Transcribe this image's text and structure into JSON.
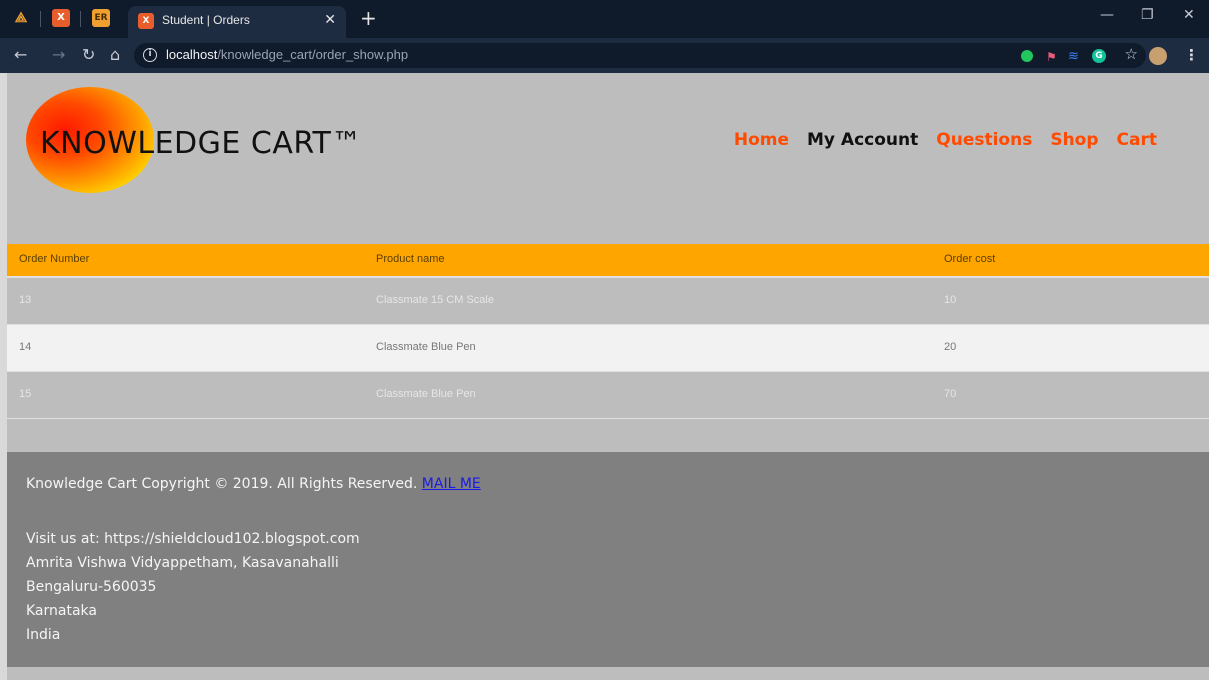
{
  "browser": {
    "pinned_tabs": [
      {
        "icon": "app-icon",
        "label": ""
      },
      {
        "icon": "xampp-icon",
        "label": "X"
      },
      {
        "icon": "er-icon",
        "label": "ER"
      }
    ],
    "active_tab": {
      "title": "Student | Orders",
      "icon": "xampp-icon"
    },
    "url_host": "localhost",
    "url_path": "/knowledge_cart/order_show.php"
  },
  "site": {
    "logo_text": "KNOWLEDGE CART™",
    "nav": [
      {
        "label": "Home",
        "active": false
      },
      {
        "label": "My Account",
        "active": true
      },
      {
        "label": "Questions",
        "active": false
      },
      {
        "label": "Shop",
        "active": false
      },
      {
        "label": "Cart",
        "active": false
      }
    ]
  },
  "orders": {
    "headers": [
      "Order Number",
      "Product name",
      "Order cost"
    ],
    "rows": [
      [
        "13",
        "Classmate 15 CM Scale",
        "10"
      ],
      [
        "14",
        "Classmate Blue Pen",
        "20"
      ],
      [
        "15",
        "Classmate Blue Pen",
        "70"
      ]
    ]
  },
  "footer": {
    "copyright": "Knowledge Cart Copyright © 2019. All Rights Reserved.",
    "mail_link": "MAIL ME",
    "visit": "Visit us at: https://shieldcloud102.blogspot.com",
    "address": [
      "Amrita Vishwa Vidyappetham, Kasavanahalli",
      "Bengaluru-560035",
      "Karnataka",
      "India"
    ]
  },
  "colors": {
    "accent": "#ff4a00",
    "table_header": "#ffa500",
    "footer_bg": "#808080"
  }
}
